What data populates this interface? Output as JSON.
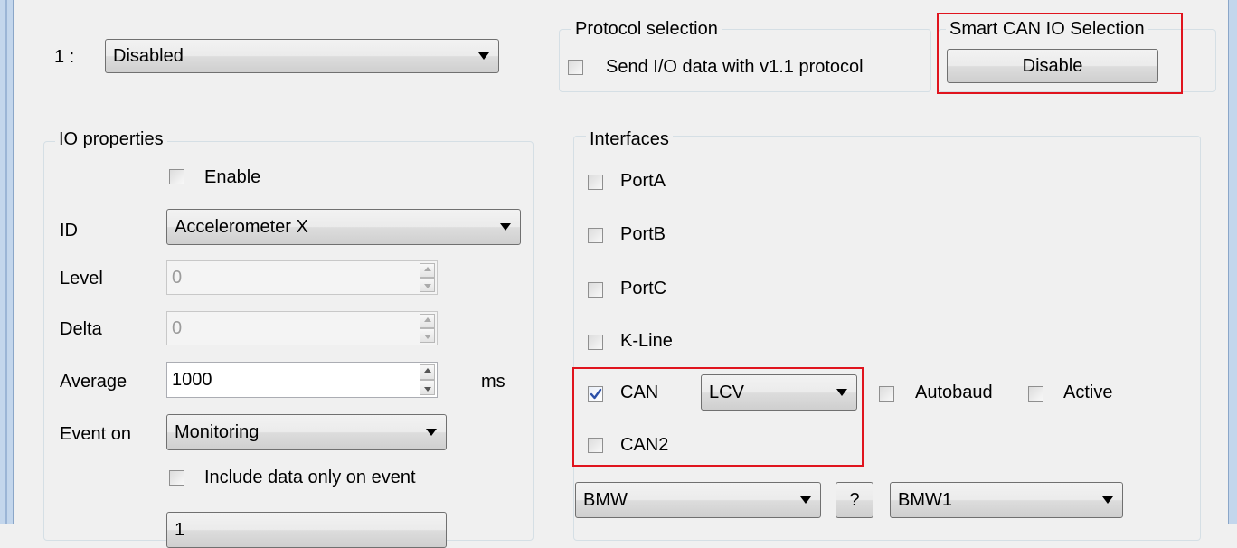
{
  "channel": {
    "index_label": "1 :",
    "mode_value": "Disabled"
  },
  "protocol": {
    "legend": "Protocol selection",
    "v11_label": "Send I/O data with v1.1 protocol",
    "v11_checked": false
  },
  "smart_can": {
    "legend": "Smart CAN IO Selection",
    "button_label": "Disable"
  },
  "io_properties": {
    "legend": "IO properties",
    "enable_label": "Enable",
    "enable_checked": false,
    "id_label": "ID",
    "id_value": "Accelerometer X",
    "level_label": "Level",
    "level_value": "0",
    "delta_label": "Delta",
    "delta_value": "0",
    "average_label": "Average",
    "average_value": "1000",
    "average_unit": "ms",
    "event_label": "Event on",
    "event_value": "Monitoring",
    "include_label": "Include data only on event",
    "include_checked": false,
    "next_value": "1"
  },
  "interfaces": {
    "legend": "Interfaces",
    "porta": "PortA",
    "portb": "PortB",
    "portc": "PortC",
    "kline": "K-Line",
    "can_label": "CAN",
    "can_checked": true,
    "can_type": "LCV",
    "autobaud": "Autobaud",
    "active": "Active",
    "can2_label": "CAN2",
    "can2_checked": false,
    "vehicle_make": "BMW",
    "help_label": "?",
    "vehicle_model": "BMW1"
  },
  "colors": {
    "highlight": "#e0141e",
    "window_bg": "#f0f0f0",
    "frame": "#c3d6ec"
  }
}
